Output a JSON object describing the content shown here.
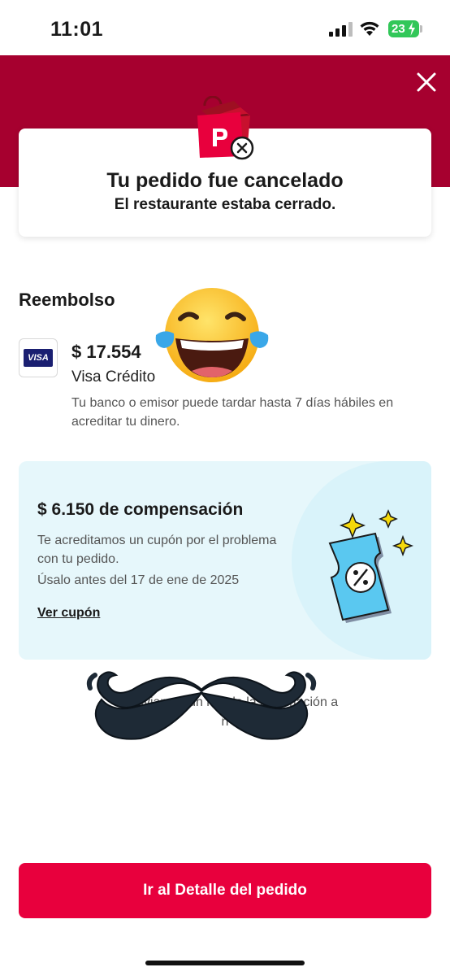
{
  "status_bar": {
    "time": "11:01",
    "battery": "23",
    "icons": [
      "signal-icon",
      "wifi-icon",
      "battery-icon"
    ]
  },
  "header": {
    "close_icon": "close-icon",
    "accent_color": "#a6002f"
  },
  "cancellation": {
    "title": "Tu pedido fue cancelado",
    "reason": "El restaurante estaba cerrado.",
    "icon": "cancelled-bag-icon"
  },
  "refund": {
    "section_title": "Reembolso",
    "card_brand": "VISA",
    "amount": "$ 17.554",
    "method": "Visa Crédito",
    "note": "Tu banco o emisor puede tardar hasta 7 días hábiles en acreditar tu dinero."
  },
  "compensation": {
    "title": "$ 6.150 de compensación",
    "text": "Te acreditamos un cupón por el problema con tu pedido.",
    "expiry": "Úsalo antes del 17 de ene de 2025",
    "link_label": "Ver cupón",
    "background_color": "#e6f7fb"
  },
  "email_notice": {
    "text": "Te enviamos un  n toda la información a\n n"
  },
  "footer": {
    "button_label": "Ir al Detalle del pedido",
    "button_color": "#e8003d"
  },
  "overlays": {
    "emoji": "laughing-tears-emoji",
    "sticker": "mustache-sticker"
  }
}
